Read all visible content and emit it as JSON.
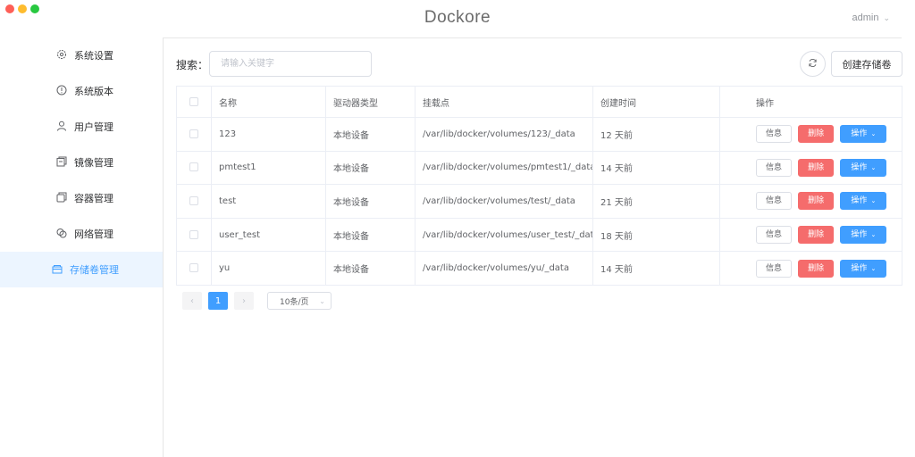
{
  "window": {
    "title": "Dockore"
  },
  "user": {
    "name": "admin",
    "chevron_icon": "chevron-down-icon"
  },
  "sidebar": {
    "items": [
      {
        "label": "系统设置",
        "icon": "gear-icon"
      },
      {
        "label": "系统版本",
        "icon": "info-icon"
      },
      {
        "label": "用户管理",
        "icon": "user-icon"
      },
      {
        "label": "镜像管理",
        "icon": "image-icon"
      },
      {
        "label": "容器管理",
        "icon": "container-icon"
      },
      {
        "label": "网络管理",
        "icon": "network-icon"
      },
      {
        "label": "存储卷管理",
        "icon": "volume-icon",
        "active": true
      }
    ]
  },
  "toolbar": {
    "search_label": "搜索：",
    "search_placeholder": "请输入关键字",
    "search_value": "",
    "refresh_icon": "refresh-icon",
    "create_label": "创建存储卷"
  },
  "table": {
    "headers": [
      "名称",
      "驱动器类型",
      "挂载点",
      "创建时间",
      "操作"
    ],
    "rows": [
      {
        "name": "123",
        "driver": "本地设备",
        "mount": "/var/lib/docker/volumes/123/_data",
        "created": "12 天前"
      },
      {
        "name": "pmtest1",
        "driver": "本地设备",
        "mount": "/var/lib/docker/volumes/pmtest1/_data",
        "created": "14 天前"
      },
      {
        "name": "test",
        "driver": "本地设备",
        "mount": "/var/lib/docker/volumes/test/_data",
        "created": "21 天前"
      },
      {
        "name": "user_test",
        "driver": "本地设备",
        "mount": "/var/lib/docker/volumes/user_test/_data",
        "created": "18 天前"
      },
      {
        "name": "yu",
        "driver": "本地设备",
        "mount": "/var/lib/docker/volumes/yu/_data",
        "created": "14 天前"
      }
    ],
    "actions": {
      "info": "信息",
      "delete": "删除",
      "ops": "操作"
    }
  },
  "pagination": {
    "current_page": "1",
    "page_size": "10条/页"
  },
  "colors": {
    "primary": "#409eff",
    "danger": "#f56c6c",
    "active_bg": "#ecf5ff"
  }
}
